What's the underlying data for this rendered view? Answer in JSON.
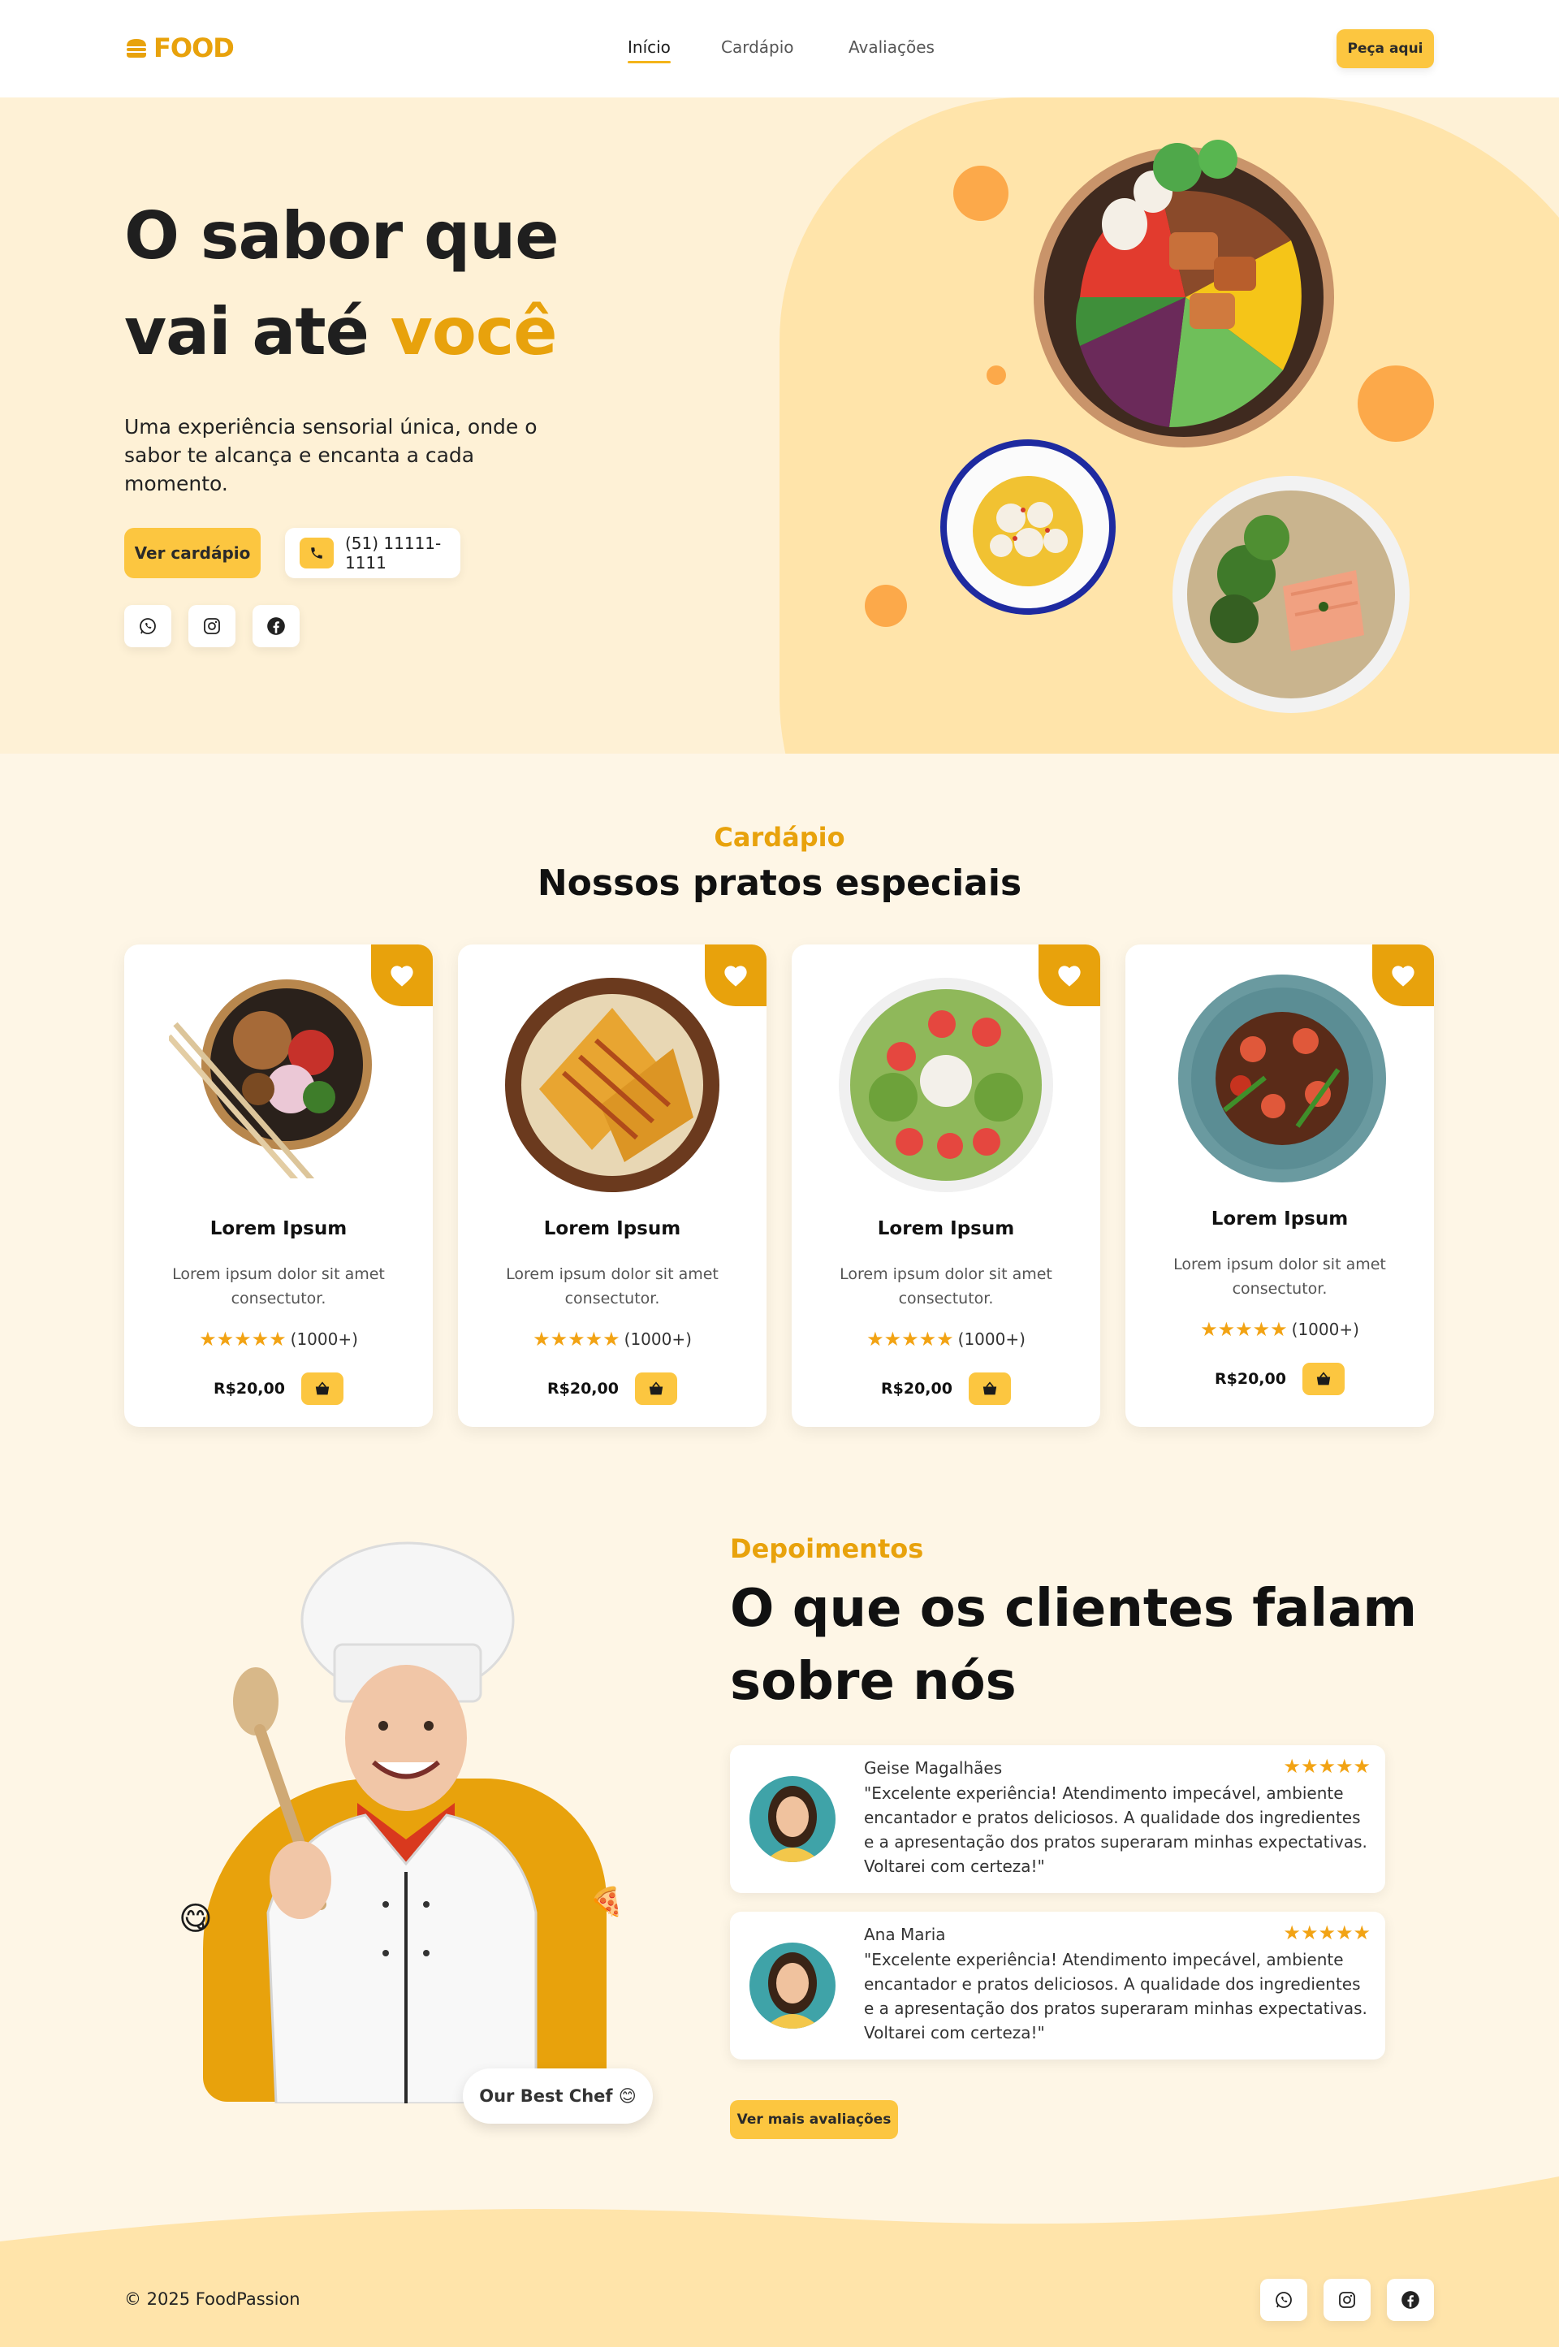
{
  "brand": {
    "name": "FOOD",
    "color": "#e8a20c"
  },
  "nav": {
    "items": [
      "Início",
      "Cardápio",
      "Avaliações"
    ],
    "cta": "Peça aqui"
  },
  "hero": {
    "title_line1": "O sabor que",
    "title_line2_plain": "vai até ",
    "title_line2_accent": "você",
    "text": "Uma experiência sensorial única, onde o sabor te alcança e encanta a cada momento.",
    "menu_button": "Ver cardápio",
    "phone": "(51) 11111-1111",
    "socials": [
      "whatsapp-icon",
      "instagram-icon",
      "facebook-icon"
    ]
  },
  "menu": {
    "label": "Cardápio",
    "title": "Nossos pratos especiais",
    "cards": [
      {
        "name": "Lorem Ipsum",
        "desc": "Lorem ipsum dolor sit amet consectutor.",
        "rating": 5,
        "count": "(1000+)",
        "price": "R$20,00"
      },
      {
        "name": "Lorem Ipsum",
        "desc": "Lorem ipsum dolor sit amet consectutor.",
        "rating": 5,
        "count": "(1000+)",
        "price": "R$20,00"
      },
      {
        "name": "Lorem Ipsum",
        "desc": "Lorem ipsum dolor sit amet consectutor.",
        "rating": 5,
        "count": "(1000+)",
        "price": "R$20,00"
      },
      {
        "name": "Lorem Ipsum",
        "desc": "Lorem ipsum dolor sit amet consectutor.",
        "rating": 5,
        "count": "(1000+)",
        "price": "R$20,00"
      }
    ]
  },
  "testimonials": {
    "label": "Depoimentos",
    "title_line1": "O que os clientes falam",
    "title_line2": "sobre nós",
    "chef_badge": "Our Best Chef 😊",
    "items": [
      {
        "name": "Geise Magalhães",
        "rating": 5,
        "text": "\"Excelente experiência! Atendimento impecável, ambiente encantador e pratos deliciosos. A qualidade dos ingredientes e a apresentação dos pratos superaram minhas expectativas. Voltarei com certeza!\""
      },
      {
        "name": "Ana Maria",
        "rating": 5,
        "text": "\"Excelente experiência! Atendimento impecável, ambiente encantador e pratos deliciosos. A qualidade dos ingredientes e a apresentação dos pratos superaram minhas expectativas. Voltarei com certeza!\""
      }
    ],
    "more_button": "Ver mais avaliações"
  },
  "footer": {
    "copyright": "© 2025 FoodPassion"
  },
  "colors": {
    "accent": "#e8a20c",
    "button": "#fcc640",
    "hero_bg": "#fef1d6",
    "page_bg": "#fef6e6"
  }
}
